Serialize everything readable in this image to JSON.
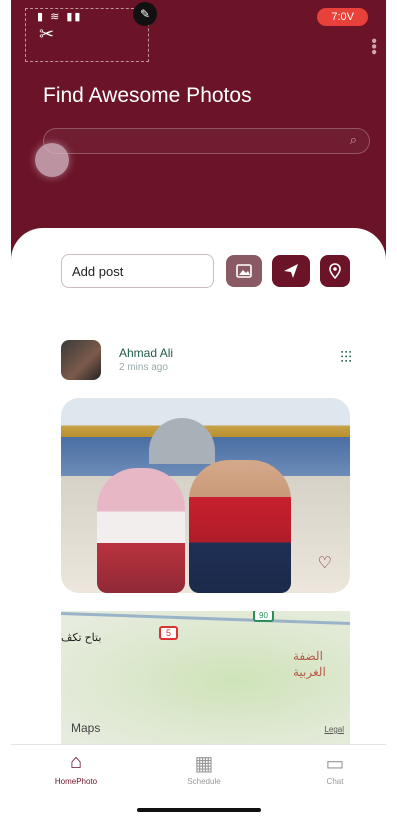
{
  "status": {
    "time": "7:0V"
  },
  "header": {
    "title": "Find Awesome Photos",
    "search": {
      "placeholder": ""
    }
  },
  "composer": {
    "placeholder": "Add post"
  },
  "post": {
    "user_name": "Ahmad Ali",
    "time": "2 mins ago"
  },
  "map": {
    "label_ar_1": "بتاح تكڤ",
    "label_ar_2": "الضفة",
    "label_ar_3": "الغربية",
    "route_5": "5",
    "route_90": "90",
    "brand": "Maps",
    "legal": "Legal"
  },
  "tabbar": {
    "items": [
      {
        "label": "HomePhoto",
        "icon": "home-icon",
        "active": true
      },
      {
        "label": "Schedule",
        "icon": "calendar-icon",
        "active": false
      },
      {
        "label": "Chat",
        "icon": "chat-icon",
        "active": false
      }
    ]
  },
  "colors": {
    "primary": "#6b1428",
    "accent": "#8a5a64",
    "status": "#e8413a"
  }
}
